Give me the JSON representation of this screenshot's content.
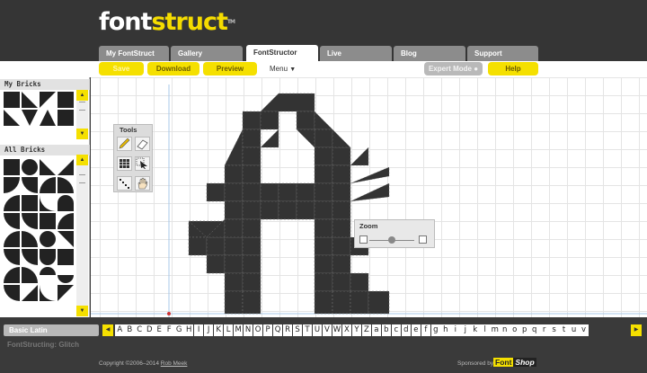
{
  "logo": {
    "part1": "font",
    "part2": "struct",
    "tm": "TM"
  },
  "tabs": [
    {
      "label": "My FontStruct"
    },
    {
      "label": "Gallery"
    },
    {
      "label": "FontStructor"
    },
    {
      "label": "Live"
    },
    {
      "label": "Blog"
    },
    {
      "label": "Support"
    }
  ],
  "toolbar": {
    "save_label": "Save",
    "download_label": "Download",
    "preview_label": "Preview",
    "menu_label": "Menu",
    "expert_label": "Expert Mode",
    "help_label": "Help"
  },
  "sidebar": {
    "my_bricks_title": "My Bricks",
    "all_bricks_title": "All Bricks"
  },
  "tools": {
    "title": "Tools"
  },
  "zoom": {
    "title": "Zoom",
    "level": 0.5
  },
  "charset": {
    "selected": "Basic Latin",
    "current_char": "A",
    "chars": [
      "A",
      "B",
      "C",
      "D",
      "E",
      "F",
      "G",
      "H",
      "I",
      "J",
      "K",
      "L",
      "M",
      "N",
      "O",
      "P",
      "Q",
      "R",
      "S",
      "T",
      "U",
      "V",
      "W",
      "X",
      "Y",
      "Z",
      "a",
      "b",
      "c",
      "d",
      "e",
      "f",
      "g",
      "h",
      "i",
      "j",
      "k",
      "l",
      "m",
      "n",
      "o",
      "p",
      "q",
      "r",
      "s",
      "t",
      "u",
      "v"
    ]
  },
  "footer": {
    "font_name": "FontStructing: Glitch",
    "copyright": "Copyright ©2006–2014",
    "author": "Rob Meek",
    "sponsored": "Sponsored by",
    "sponsor_a": "Font",
    "sponsor_b": "Shop"
  },
  "colors": {
    "accent": "#f5e000",
    "header_bg": "#353535",
    "brick": "#333333"
  }
}
